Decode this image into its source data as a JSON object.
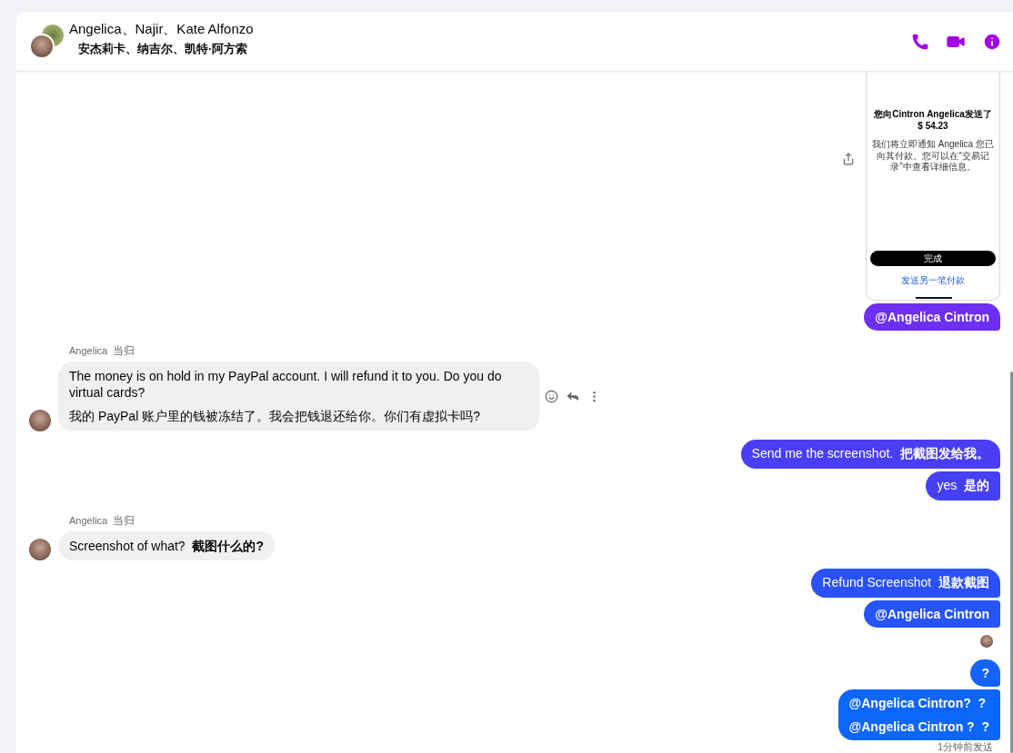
{
  "header": {
    "title": "Angelica、Najir、Kate Alfonzo",
    "subtitle": "安杰莉卡、纳吉尔、凯特·阿方索"
  },
  "messages": [
    {
      "kind": "screenshot",
      "title": "您向Cintron Angelica发送了$ 54.23",
      "note": "我们将立即通知 Angelica 您已向其付款。您可以在“交易记录”中查看详细信息。",
      "button": "完成",
      "link": "发送另一笔付款"
    },
    {
      "kind": "outgoing",
      "lines": [
        "**@Angelica Cintron**"
      ],
      "color": "#6d2ff2"
    },
    {
      "kind": "incoming",
      "sender": "Angelica",
      "sender_translation": "当归",
      "lines": [
        "The money is on hold in my PayPal account. I will refund it to you. Do you do virtual cards?",
        "我的 PayPal 账户里的钱被冻结了。我会把钱退还给你。你们有虚拟卡吗?"
      ],
      "hovered": true
    },
    {
      "kind": "outgoing",
      "lines": [
        "Send me the screenshot.  **把截图发给我。**"
      ],
      "color": "#4a3ef5"
    },
    {
      "kind": "outgoing",
      "lines": [
        "yes  **是的**"
      ],
      "color": "#4640f5"
    },
    {
      "kind": "incoming",
      "sender": "Angelica",
      "sender_translation": "当归",
      "lines": [
        "Screenshot of what?  **截图什么的?**"
      ],
      "hovered": false
    },
    {
      "kind": "outgoing",
      "lines": [
        "Refund Screenshot  **退款截图**"
      ],
      "color": "#2a50f7"
    },
    {
      "kind": "outgoing",
      "lines": [
        "**@Angelica Cintron**"
      ],
      "color": "#2654f7"
    },
    {
      "kind": "read_receipt"
    },
    {
      "kind": "outgoing",
      "lines": [
        "**?**"
      ],
      "color": "#1463fa"
    },
    {
      "kind": "outgoing",
      "lines": [
        "**@Angelica Cintron?  ?**",
        "**@Angelica Cintron ?  ?**"
      ],
      "color": "#0d66fb"
    },
    {
      "kind": "status",
      "text": "1分钟前发送"
    }
  ]
}
